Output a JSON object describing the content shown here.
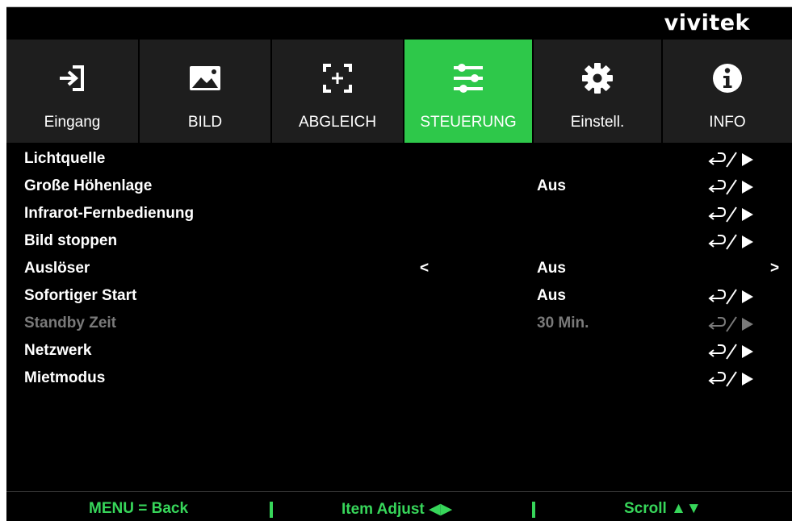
{
  "brand": "vivitek",
  "tabs": [
    {
      "label": "Eingang",
      "icon": "input-icon",
      "active": false
    },
    {
      "label": "BILD",
      "icon": "image-icon",
      "active": false
    },
    {
      "label": "ABGLEICH",
      "icon": "alignment-icon",
      "active": false
    },
    {
      "label": "STEUERUNG",
      "icon": "sliders-icon",
      "active": true
    },
    {
      "label": "Einstell.",
      "icon": "gear-icon",
      "active": false
    },
    {
      "label": "INFO",
      "icon": "info-icon",
      "active": false
    }
  ],
  "rows": [
    {
      "name": "Lichtquelle",
      "value": "",
      "enter": true
    },
    {
      "name": "Große Höhenlage",
      "value": "Aus",
      "enter": true
    },
    {
      "name": "Infrarot-Fernbedienung",
      "value": "",
      "enter": true
    },
    {
      "name": "Bild stoppen",
      "value": "",
      "enter": true
    },
    {
      "name": "Auslöser",
      "value": "Aus",
      "left": "<",
      "right": ">"
    },
    {
      "name": "Sofortiger Start",
      "value": "Aus",
      "enter": true
    },
    {
      "name": "Standby Zeit",
      "value": "30 Min.",
      "enter": true,
      "disabled": true
    },
    {
      "name": "Netzwerk",
      "value": "",
      "enter": true
    },
    {
      "name": "Mietmodus",
      "value": "",
      "enter": true
    }
  ],
  "footer": {
    "back": "MENU = Back",
    "adjust": "Item Adjust ◀▶",
    "scroll": "Scroll ▲▼"
  },
  "colors": {
    "accent": "#2ec84a",
    "footer_text": "#37d65a",
    "disabled_text": "#7a7a7a"
  }
}
